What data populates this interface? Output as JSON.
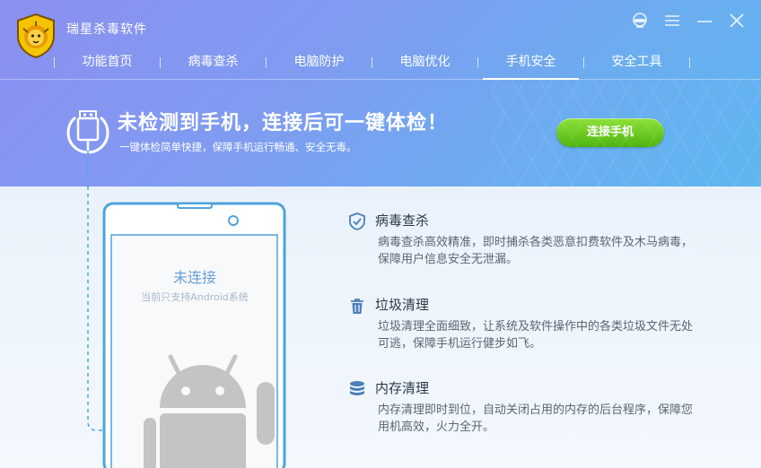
{
  "app": {
    "title": "瑞星杀毒软件"
  },
  "window_controls": [
    {
      "name": "feedback-icon",
      "glyph": "☺"
    },
    {
      "name": "menu-icon",
      "glyph": "☰"
    },
    {
      "name": "minimize-icon",
      "glyph": "—"
    },
    {
      "name": "close-icon",
      "glyph": "✕"
    }
  ],
  "nav": {
    "items": [
      {
        "label": "功能首页"
      },
      {
        "label": "病毒查杀"
      },
      {
        "label": "电脑防护"
      },
      {
        "label": "电脑优化"
      },
      {
        "label": "手机安全",
        "active": true
      },
      {
        "label": "安全工具"
      }
    ]
  },
  "banner": {
    "headline": "未检测到手机，连接后可一键体检！",
    "subline": "一键体检简单快捷，保障手机运行畅通、安全无毒。",
    "connect_button": "连接手机"
  },
  "phone": {
    "status": "未连接",
    "note": "当前只支持Android系统"
  },
  "features": [
    {
      "icon": "shield-check-icon",
      "title": "病毒查杀",
      "desc": "病毒查杀高效精准，即时捕杀各类恶意扣费软件及木马病毒，保障用户信息安全无泄漏。"
    },
    {
      "icon": "trash-icon",
      "title": "垃圾清理",
      "desc": "垃圾清理全面细致，让系统及软件操作中的各类垃圾文件无处可逃，保障手机运行健步如飞。"
    },
    {
      "icon": "memory-stack-icon",
      "title": "内存清理",
      "desc": "内存清理即时到位，自动关闭占用的内存的后台程序，保障您用机高效，火力全开。"
    }
  ],
  "colors": {
    "header_start": "#8c8ff0",
    "header_end": "#5fb6ef",
    "connect_button": "#5fc21f",
    "accent_blue": "#4a90d9"
  }
}
